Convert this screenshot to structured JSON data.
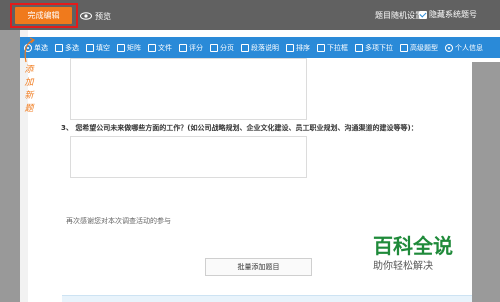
{
  "header": {
    "finish_label": "完成编辑",
    "preview_label": "预览",
    "random_setting_label": "题目随机设置",
    "hide_number_label": "隐藏系统题号",
    "hide_number_checked": true
  },
  "toolbar": {
    "items": [
      {
        "label": "单选",
        "icon": "radio-icon"
      },
      {
        "label": "多选",
        "icon": "checkbox-icon"
      },
      {
        "label": "填空",
        "icon": "fill-blank-icon"
      },
      {
        "label": "矩阵",
        "icon": "matrix-icon"
      },
      {
        "label": "文件",
        "icon": "paperclip-icon"
      },
      {
        "label": "评分",
        "icon": "star-icon"
      },
      {
        "label": "分页",
        "icon": "page-break-icon"
      },
      {
        "label": "段落说明",
        "icon": "paragraph-icon"
      },
      {
        "label": "排序",
        "icon": "sort-icon"
      },
      {
        "label": "下拉框",
        "icon": "dropdown-icon"
      },
      {
        "label": "多项下拉",
        "icon": "multi-dropdown-icon"
      },
      {
        "label": "高级题型",
        "icon": "advanced-icon"
      },
      {
        "label": "个人信息",
        "icon": "person-icon"
      }
    ]
  },
  "side_label": "添加新题",
  "question3": {
    "number": "3、",
    "text": "您希望公司未来做哪些方面的工作？(如公司战略规划、企业文化建设、员工职业规划、沟通渠道的建设等等)："
  },
  "thanks_text": "再次感谢您对本次调查活动的参与",
  "batch_add_label": "批量添加题目",
  "watermark": {
    "title": "百科全说",
    "subtitle": "助你轻松解决"
  },
  "colors": {
    "topbar": "#616161",
    "toolbar": "#2a8ad8",
    "finish_button": "#f07a1c",
    "highlight_box": "#e21b1b",
    "watermark_green": "#1f8a3a"
  }
}
